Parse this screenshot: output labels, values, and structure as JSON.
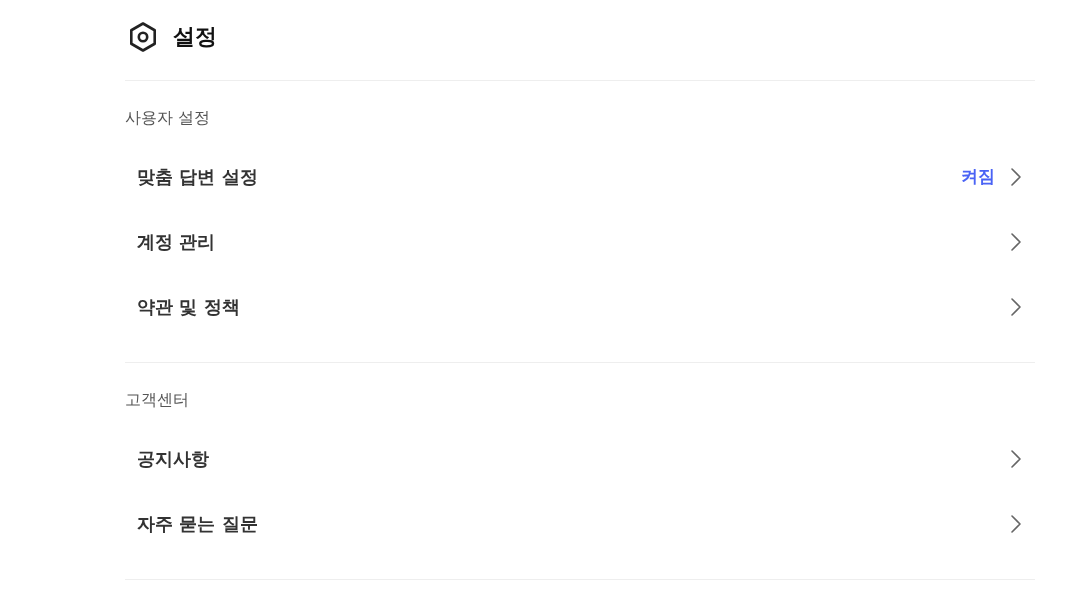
{
  "header": {
    "title": "설정"
  },
  "sections": [
    {
      "title": "사용자 설정",
      "items": [
        {
          "label": "맞춤 답변 설정",
          "status": "켜짐"
        },
        {
          "label": "계정 관리"
        },
        {
          "label": "약관 및 정책"
        }
      ]
    },
    {
      "title": "고객센터",
      "items": [
        {
          "label": "공지사항"
        },
        {
          "label": "자주 묻는 질문"
        }
      ]
    }
  ]
}
